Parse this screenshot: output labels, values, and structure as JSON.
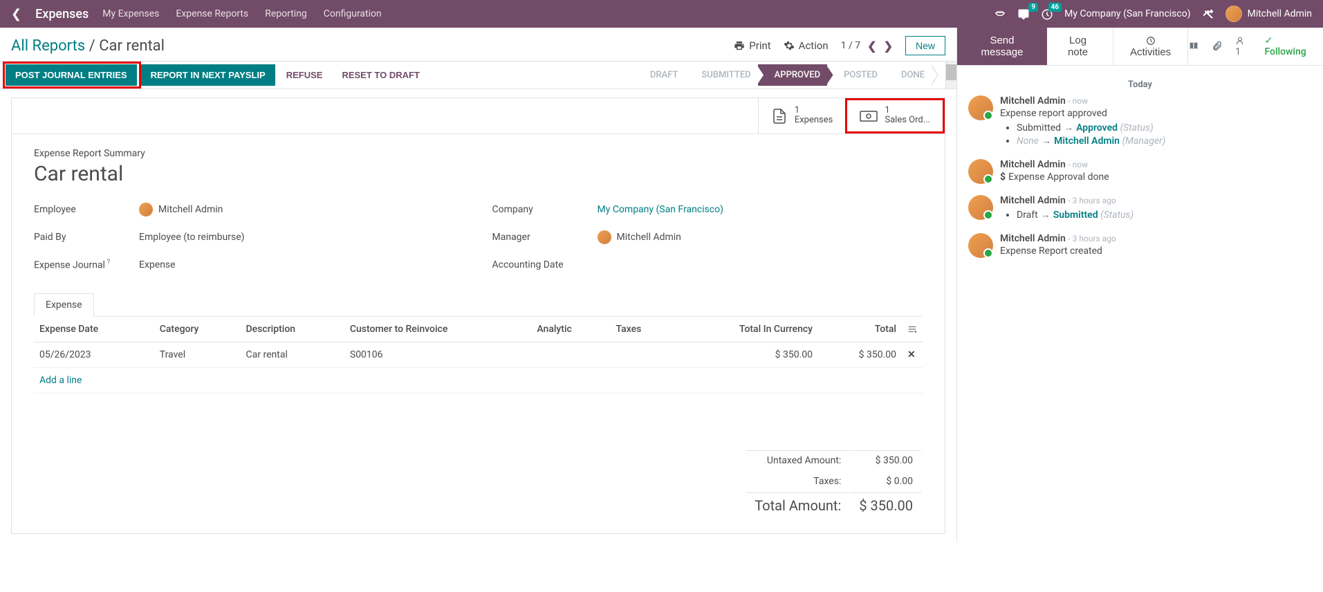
{
  "nav": {
    "brand": "Expenses",
    "menu": [
      "My Expenses",
      "Expense Reports",
      "Reporting",
      "Configuration"
    ],
    "messages_badge": "9",
    "activities_badge": "46",
    "company": "My Company (San Francisco)",
    "user": "Mitchell Admin"
  },
  "breadcrumb": {
    "parent": "All Reports",
    "current": "Car rental"
  },
  "cp": {
    "print": "Print",
    "action": "Action",
    "pager": "1 / 7",
    "new": "New"
  },
  "actions": {
    "post_journal": "POST JOURNAL ENTRIES",
    "report_payslip": "REPORT IN NEXT PAYSLIP",
    "refuse": "REFUSE",
    "reset": "RESET TO DRAFT"
  },
  "status_steps": [
    "DRAFT",
    "SUBMITTED",
    "APPROVED",
    "POSTED",
    "DONE"
  ],
  "status_active_index": 2,
  "stat_buttons": {
    "expenses": {
      "count": "1",
      "label": "Expenses"
    },
    "sales": {
      "count": "1",
      "label": "Sales Ord..."
    }
  },
  "form": {
    "summary_label": "Expense Report Summary",
    "title": "Car rental",
    "labels": {
      "employee": "Employee",
      "paid_by": "Paid By",
      "journal": "Expense Journal",
      "company": "Company",
      "manager": "Manager",
      "acc_date": "Accounting Date"
    },
    "values": {
      "employee": "Mitchell Admin",
      "paid_by": "Employee (to reimburse)",
      "journal": "Expense",
      "company": "My Company (San Francisco)",
      "manager": "Mitchell Admin",
      "acc_date": ""
    }
  },
  "notebook": {
    "tab": "Expense"
  },
  "table": {
    "headers": {
      "date": "Expense Date",
      "category": "Category",
      "description": "Description",
      "customer": "Customer to Reinvoice",
      "analytic": "Analytic",
      "taxes": "Taxes",
      "total_currency": "Total In Currency",
      "total": "Total"
    },
    "row": {
      "date": "05/26/2023",
      "category": "Travel",
      "description": "Car rental",
      "customer": "S00106",
      "analytic": "",
      "taxes": "",
      "total_currency": "$ 350.00",
      "total": "$ 350.00"
    },
    "add_line": "Add a line"
  },
  "totals": {
    "untaxed_label": "Untaxed Amount:",
    "untaxed_value": "$ 350.00",
    "taxes_label": "Taxes:",
    "taxes_value": "$ 0.00",
    "total_label": "Total Amount:",
    "total_value": "$ 350.00"
  },
  "chatter": {
    "send": "Send message",
    "log": "Log note",
    "activities": "Activities",
    "follower_count": "1",
    "following": "Following",
    "today": "Today",
    "messages": [
      {
        "author": "Mitchell Admin",
        "time": "now",
        "content": "Expense report approved",
        "changes": [
          {
            "field": "Submitted",
            "to": "Approved",
            "meta": "(Status)"
          },
          {
            "field": "None",
            "to": "Mitchell Admin",
            "meta": "(Manager)",
            "field_italic": true
          }
        ]
      },
      {
        "author": "Mitchell Admin",
        "time": "now",
        "icon": "dollar",
        "content": "Expense Approval done"
      },
      {
        "author": "Mitchell Admin",
        "time": "3 hours ago",
        "changes": [
          {
            "field": "Draft",
            "to": "Submitted",
            "meta": "(Status)"
          }
        ]
      },
      {
        "author": "Mitchell Admin",
        "time": "3 hours ago",
        "content": "Expense Report created"
      }
    ]
  }
}
